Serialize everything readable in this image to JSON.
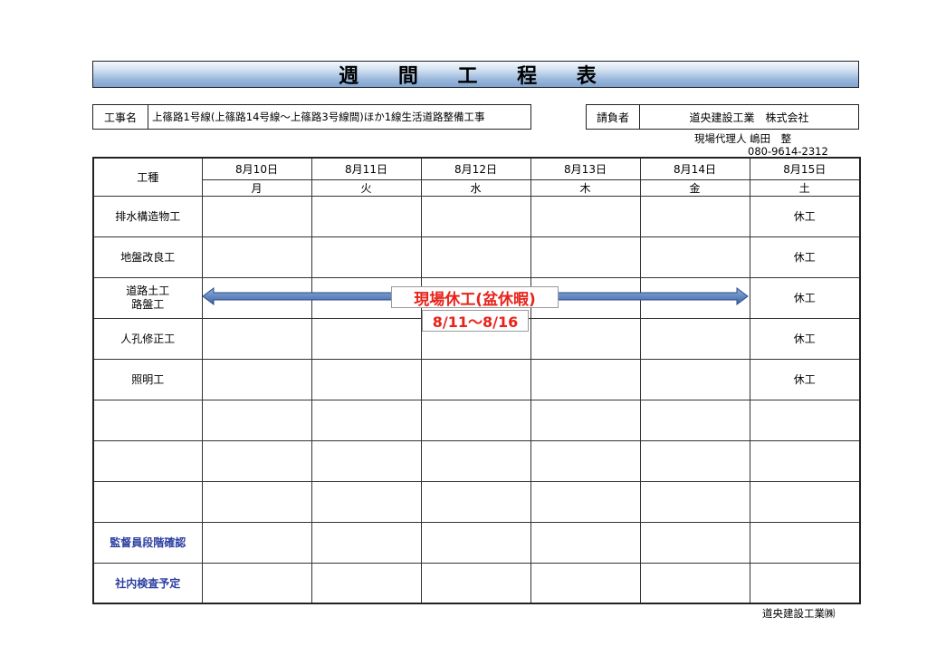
{
  "title": "週 間 工 程 表",
  "header": {
    "project_label": "工事名",
    "project_name": "上篠路1号線(上篠路14号線～上篠路3号線間)ほか1線生活道路整備工事",
    "contractor_label": "請負者",
    "contractor_name": "道央建設工業　株式会社",
    "agent_line": "現場代理人 嶋田　整",
    "phone": "080-9614-2312"
  },
  "table": {
    "work_type_label": "工種",
    "days": [
      {
        "date": "8月10日",
        "weekday": "月"
      },
      {
        "date": "8月11日",
        "weekday": "火"
      },
      {
        "date": "8月12日",
        "weekday": "水"
      },
      {
        "date": "8月13日",
        "weekday": "木"
      },
      {
        "date": "8月14日",
        "weekday": "金"
      },
      {
        "date": "8月15日",
        "weekday": "土"
      }
    ],
    "rows": [
      {
        "name": "排水構造物工",
        "sat": "休工"
      },
      {
        "name": "地盤改良工",
        "sat": "休工"
      },
      {
        "name": "道路土工\n路盤工",
        "sat": "休工"
      },
      {
        "name": "人孔修正工",
        "sat": "休工"
      },
      {
        "name": "照明工",
        "sat": "休工"
      },
      {
        "name": "",
        "sat": ""
      },
      {
        "name": "",
        "sat": ""
      },
      {
        "name": "",
        "sat": ""
      }
    ],
    "footer_rows": [
      {
        "name": "監督員段階確認"
      },
      {
        "name": "社内検査予定"
      }
    ]
  },
  "holiday_note": {
    "line1": "現場休工(盆休暇)",
    "line2": "8/11～8/16"
  },
  "company_footer": "道央建設工業㈱",
  "colors": {
    "title_gradient": "#9ab8dc",
    "arrow": "#4a6fa8",
    "red_text": "#e8231b",
    "blue_text": "#2b3fa0"
  }
}
